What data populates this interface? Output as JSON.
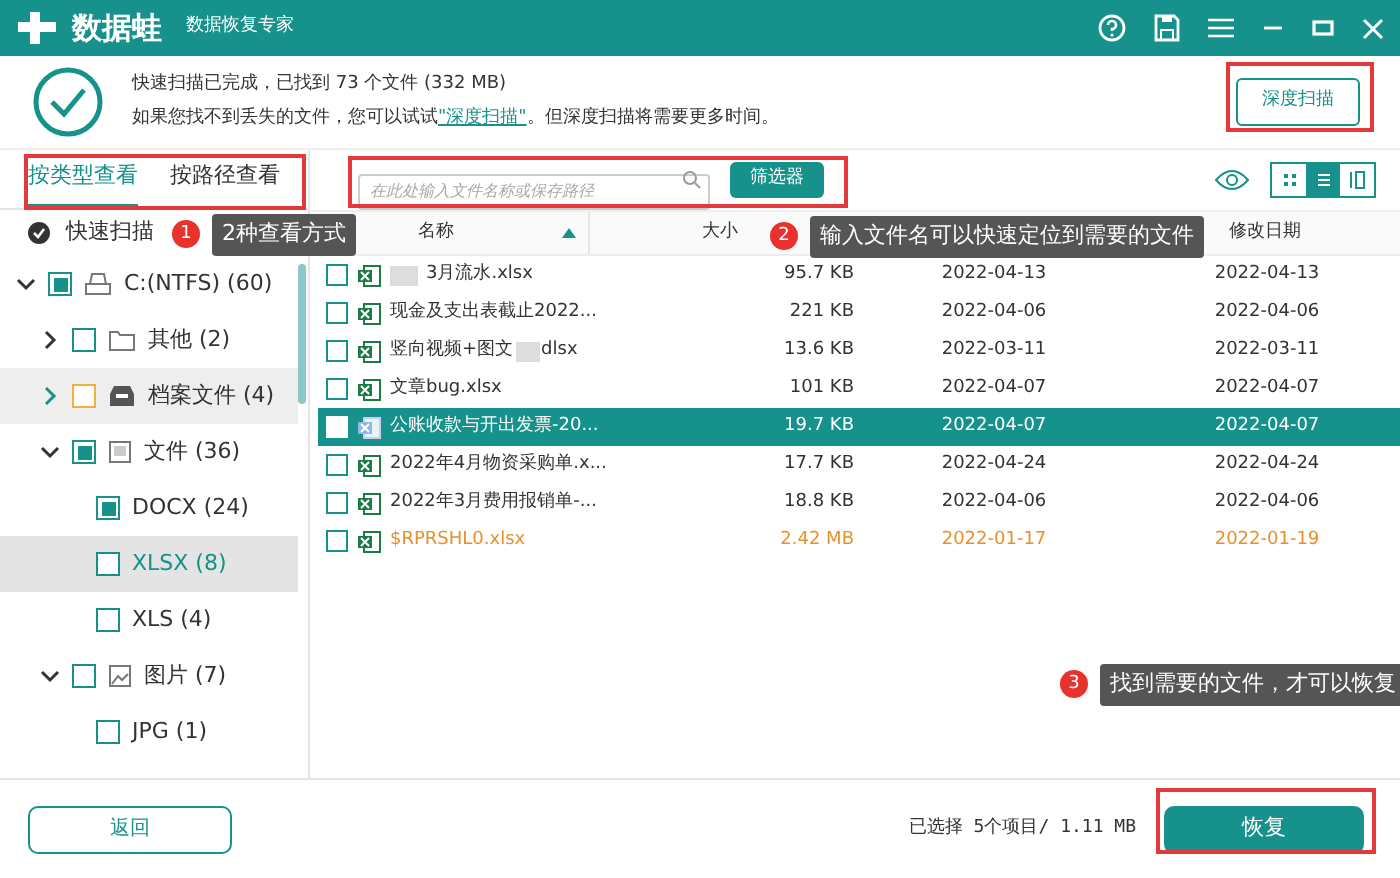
{
  "app": {
    "name": "数据蛙",
    "subtitle": "数据恢复专家"
  },
  "header": {
    "line1": "快速扫描已完成，已找到 73 个文件 (332 MB)",
    "line2_before": "如果您找不到丢失的文件，您可以试试",
    "line2_link": "\"深度扫描\"",
    "line2_after": "。但深度扫描将需要更多时间。",
    "deep_scan_button": "深度扫描"
  },
  "view_tabs": [
    {
      "label": "按类型查看",
      "selected": true
    },
    {
      "label": "按路径查看",
      "selected": false
    }
  ],
  "search": {
    "placeholder": "在此处输入文件名称或保存路径"
  },
  "filter_button": "筛选器",
  "view_modes": [
    {
      "kind": "grid",
      "selected": false
    },
    {
      "kind": "list",
      "selected": true
    },
    {
      "kind": "columns",
      "selected": false
    }
  ],
  "scan_label": "快速扫描",
  "tree": [
    {
      "label": "C:(NTFS) (60)",
      "kind": "drive",
      "checked": true,
      "expanded": true,
      "children": [
        {
          "label": "其他 (2)",
          "kind": "folder",
          "checked": false,
          "expanded": false,
          "highlighted": false
        },
        {
          "label": "档案文件 (4)",
          "kind": "archive",
          "checked": false,
          "expanded": false,
          "highlighted": true
        },
        {
          "label": "文件 (36)",
          "kind": "document",
          "checked": true,
          "expanded": true,
          "highlighted": false,
          "children": [
            {
              "label": "DOCX (24)",
              "checked": true,
              "selected": false
            },
            {
              "label": "XLSX (8)",
              "checked": false,
              "selected": true
            },
            {
              "label": "XLS (4)",
              "checked": false,
              "selected": false
            }
          ]
        },
        {
          "label": "图片 (7)",
          "kind": "image",
          "checked": false,
          "expanded": true,
          "highlighted": false,
          "children": [
            {
              "label": "JPG (1)",
              "checked": false,
              "selected": false
            }
          ]
        }
      ]
    }
  ],
  "table": {
    "columns": [
      "名称",
      "大小",
      "修改日期"
    ],
    "rows": [
      {
        "kind": "blur_start",
        "name": "3月流水.xlsx",
        "size": "95.7 KB",
        "date": "2022-04-13",
        "modified": "2022-04-13",
        "checked": false,
        "selected": false,
        "color": "#333333"
      },
      {
        "kind": "plain",
        "name": "现金及支出表截止2022...",
        "size": "221 KB",
        "date": "2022-04-06",
        "modified": "2022-04-06",
        "checked": false,
        "selected": false,
        "color": "#333333"
      },
      {
        "kind": "blur_middle",
        "name": "竖向视频+图文",
        "tail": "dlsx",
        "size": "13.6 KB",
        "date": "2022-03-11",
        "modified": "2022-03-11",
        "checked": false,
        "selected": false,
        "color": "#333333"
      },
      {
        "kind": "plain",
        "name": "文章bug.xlsx",
        "size": "101 KB",
        "date": "2022-04-07",
        "modified": "2022-04-07",
        "checked": false,
        "selected": false,
        "color": "#333333"
      },
      {
        "kind": "plain",
        "name": "公账收款与开出发票-20...",
        "size": "19.7 KB",
        "date": "2022-04-07",
        "modified": "2022-04-07",
        "checked": false,
        "selected": true,
        "color": "#ffffff"
      },
      {
        "kind": "plain",
        "name": "2022年4月物资采购单.x...",
        "size": "17.7 KB",
        "date": "2022-04-24",
        "modified": "2022-04-24",
        "checked": false,
        "selected": false,
        "color": "#333333"
      },
      {
        "kind": "plain",
        "name": "2022年3月费用报销单-...",
        "size": "18.8 KB",
        "date": "2022-04-06",
        "modified": "2022-04-06",
        "checked": false,
        "selected": false,
        "color": "#333333"
      },
      {
        "kind": "plain",
        "name": "$RPRSHL0.xlsx",
        "size": "2.42 MB",
        "date": "2022-01-17",
        "modified": "2022-01-19",
        "checked": false,
        "selected": false,
        "color": "#e8902a"
      }
    ]
  },
  "callouts": [
    {
      "number": "1",
      "text": "2种查看方式"
    },
    {
      "number": "2",
      "text": "输入文件名可以快速定位到需要的文件"
    },
    {
      "number": "3",
      "text": "找到需要的文件，才可以恢复"
    }
  ],
  "footer": {
    "back_button": "返回",
    "selection": "已选择 5个项目/ 1.11 MB",
    "recover_button": "恢复"
  }
}
